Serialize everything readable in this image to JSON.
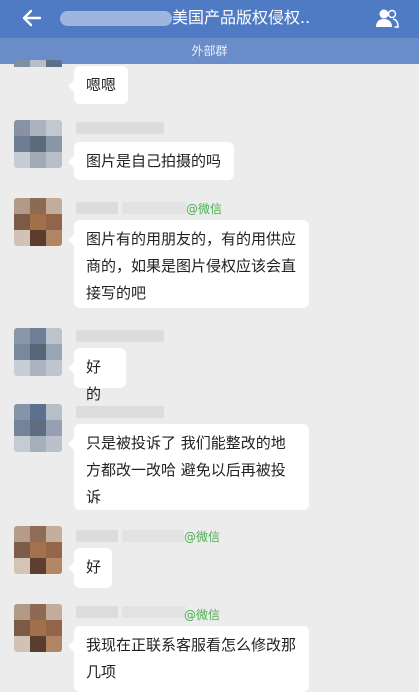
{
  "header": {
    "title": "美国产品版权侵权..",
    "subtitle": "外部群",
    "back_icon": "arrow-left-icon",
    "group_icon": "group-members-icon"
  },
  "messages": [
    {
      "sender_tag": "",
      "text": "嗯嗯"
    },
    {
      "sender_tag": "",
      "text": "图片是自己拍摄的吗"
    },
    {
      "sender_tag": "@微信",
      "text": "图片有的用朋友的，有的用供应商的，如果是图片侵权应该会直接写的吧"
    },
    {
      "sender_tag": "",
      "text": "好的"
    },
    {
      "sender_tag": "",
      "text": "只是被投诉了 我们能整改的地方都改一改哈 避免以后再被投诉"
    },
    {
      "sender_tag": "@微信",
      "text": "好"
    },
    {
      "sender_tag": "@微信",
      "text": "我现在正联系客服看怎么修改那几项"
    }
  ],
  "colors": {
    "topbar": "#4f7bc4",
    "subbar": "#6a8dc9",
    "chat_background": "#ececec",
    "bubble": "#ffffff",
    "tag": "#4caf50"
  }
}
